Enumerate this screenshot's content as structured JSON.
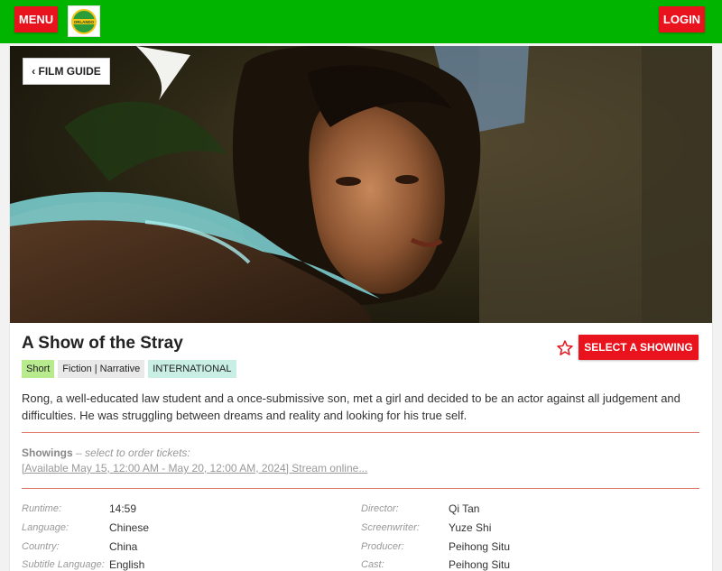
{
  "header": {
    "menu_label": "MENU",
    "login_label": "LOGIN",
    "logo_text": "ORLANDO"
  },
  "hero": {
    "back_label": "‹ FILM GUIDE"
  },
  "film": {
    "title": "A Show of the Stray",
    "tags": [
      "Short",
      "Fiction | Narrative",
      "INTERNATIONAL"
    ],
    "select_label": "SELECT A SHOWING",
    "description": "Rong, a well-educated law student and a once-submissive son, met a girl and decided to be an actor against all judgement and difficulties. He was struggling between dreams and reality and looking for his true self."
  },
  "showings": {
    "heading": "Showings",
    "hint": "– select to order tickets:",
    "link": "[Available May 15, 12:00 AM - May 20, 12:00 AM, 2024] Stream online..."
  },
  "details_left": [
    {
      "label": "Runtime:",
      "value": "14:59"
    },
    {
      "label": "Language:",
      "value": "Chinese"
    },
    {
      "label": "Country:",
      "value": "China"
    },
    {
      "label": "Subtitle Language:",
      "value": "English"
    }
  ],
  "details_right": [
    {
      "label": "Director:",
      "value": "Qi Tan"
    },
    {
      "label": "Screenwriter:",
      "value": "Yuze Shi"
    },
    {
      "label": "Producer:",
      "value": "Peihong Situ"
    },
    {
      "label": "Cast:",
      "value": "Peihong Situ"
    }
  ],
  "colors": {
    "header_green": "#00b400",
    "accent_red": "#e8131d",
    "rule_red": "#e07a6e"
  }
}
